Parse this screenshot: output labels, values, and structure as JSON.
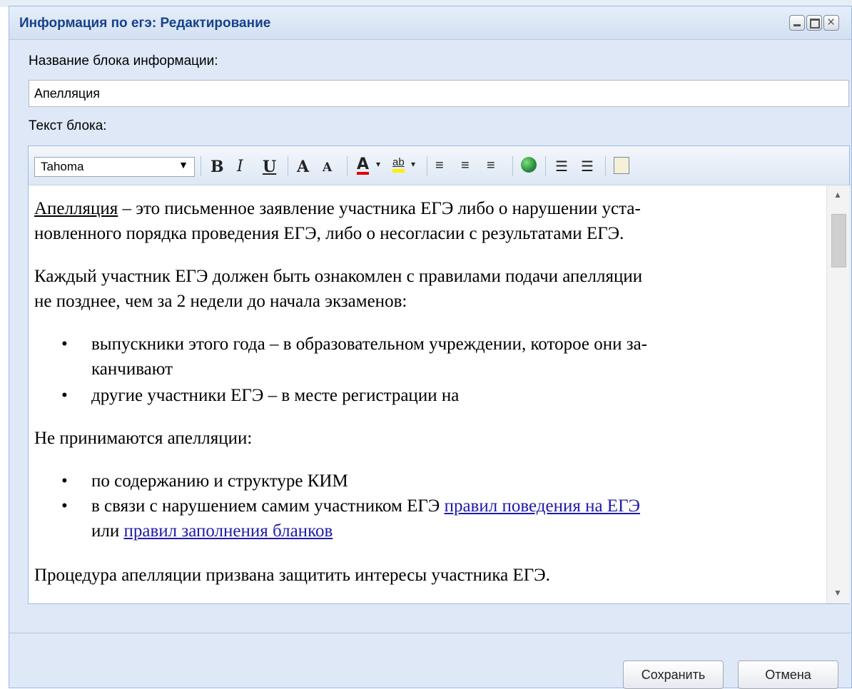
{
  "dialog": {
    "title": "Информация по егэ: Редактирование"
  },
  "form": {
    "name_label": "Название блока информации:",
    "name_value": "Апелляция",
    "text_label": "Текст блока:"
  },
  "toolbar": {
    "font": "Tahoma",
    "bold": "B",
    "italic": "I",
    "underline": "U",
    "grow": "A",
    "shrink": "A",
    "color": "A",
    "highlight": "ab"
  },
  "content": {
    "p1_term": "Апелляция",
    "p1_rest_line1": " – это письменное заявление участника ЕГЭ либо о нарушении уста-",
    "p1_line2": "новленного порядка проведения ЕГЭ, либо о несогласии с результатами ЕГЭ.",
    "p2_line1": "Каждый участник ЕГЭ должен быть ознакомлен с правилами подачи апелляции",
    "p2_line2": "не позднее, чем за 2 недели до начала экзаменов:",
    "list1_item1_line1": "выпускники этого года – в образовательном учреждении, которое они за-",
    "list1_item1_line2": "канчивают",
    "list1_item2": "другие участники ЕГЭ – в месте регистрации на",
    "p3": "Не принимаются апелляции:",
    "list2_item1": "по содержанию и структуре КИМ",
    "list2_item2_pre": "в связи с нарушением самим участником ЕГЭ ",
    "list2_item2_link1": "правил поведения на ЕГЭ",
    "list2_item2_mid": "или ",
    "list2_item2_link2": "правил заполнения бланков",
    "p4": "Процедура апелляции призвана защитить интересы участника ЕГЭ."
  },
  "buttons": {
    "save": "Сохранить",
    "cancel": "Отмена"
  }
}
